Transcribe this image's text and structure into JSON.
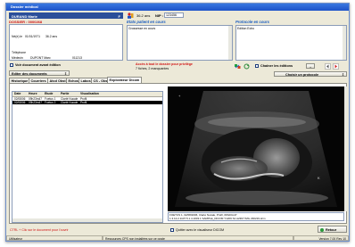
{
  "window": {
    "title": "Dossier médical"
  },
  "patient": {
    "name": "DURAND Marie",
    "sex": "F",
    "dossier": "DOSSIER : 0000268",
    "birth_label": "Né(e) le",
    "birth_date": "01/01/1971",
    "age": "36.2 ans",
    "phone_label": "Téléphone",
    "doctor_label": "Médecin",
    "doctor_name": "DUPONT Marc",
    "doctor_code": "011213",
    "header_age": "36.2 ans",
    "nip_label": "NIP :",
    "nip_value": "123456"
  },
  "panels": {
    "etats_title": "Etats patient en cours",
    "etats_content": "Grossesse en cours",
    "protocole_title": "Protocole en cours",
    "protocole_content": "Edition Echo"
  },
  "options": {
    "voir_document": "Voir document avant édition",
    "editer_documents": "Editer des documents",
    "acces_warning": "Accès à tout le dossier pour privilège",
    "fiches_count": "7 fiches, 2 manquantes",
    "chainer_label": "Chaîner les éditions",
    "choisir_protocole": "Choisir un protocole"
  },
  "tabs": [
    "Historique",
    "Courriers",
    "Atcd Obst",
    "Echos",
    "Labos",
    "CS - Obst",
    "Explorateur Dicom"
  ],
  "table": {
    "headers": [
      "Date",
      "Heure",
      "Etude",
      "Partie",
      "Visualisation"
    ],
    "rows": [
      {
        "date": "02/08/06",
        "heure": "09h23m47",
        "etude": "Foetus 1",
        "partie": "Clarté Nucale",
        "vis": "Profil"
      },
      {
        "date": "02/08/06",
        "heure": "09h23m47",
        "etude": "Foetus 2",
        "partie": "Clarté Nucale",
        "vis": "Profil"
      }
    ]
  },
  "dicom": {
    "info_line1": "FOETUS 1, 02/08/2006, Clarté Nucale, Profil, 09h23m47",
    "info_line2": "1.3.12.2.1107.5.1.4.1003.1 SAMPLE_DICOM Y1209 S1 A2367 IMG 230219.dcm",
    "quit_label": "Quitter avec le visualiseur DICOM"
  },
  "footer": {
    "hint": "CTRL + Clic sur le document pour l'ouvrir",
    "retour": "Retour"
  },
  "status": {
    "user": "Utilisateur",
    "resources": "Ressources CPS non installées sur ce poste",
    "version": "Version 7.00 Rev 10"
  }
}
